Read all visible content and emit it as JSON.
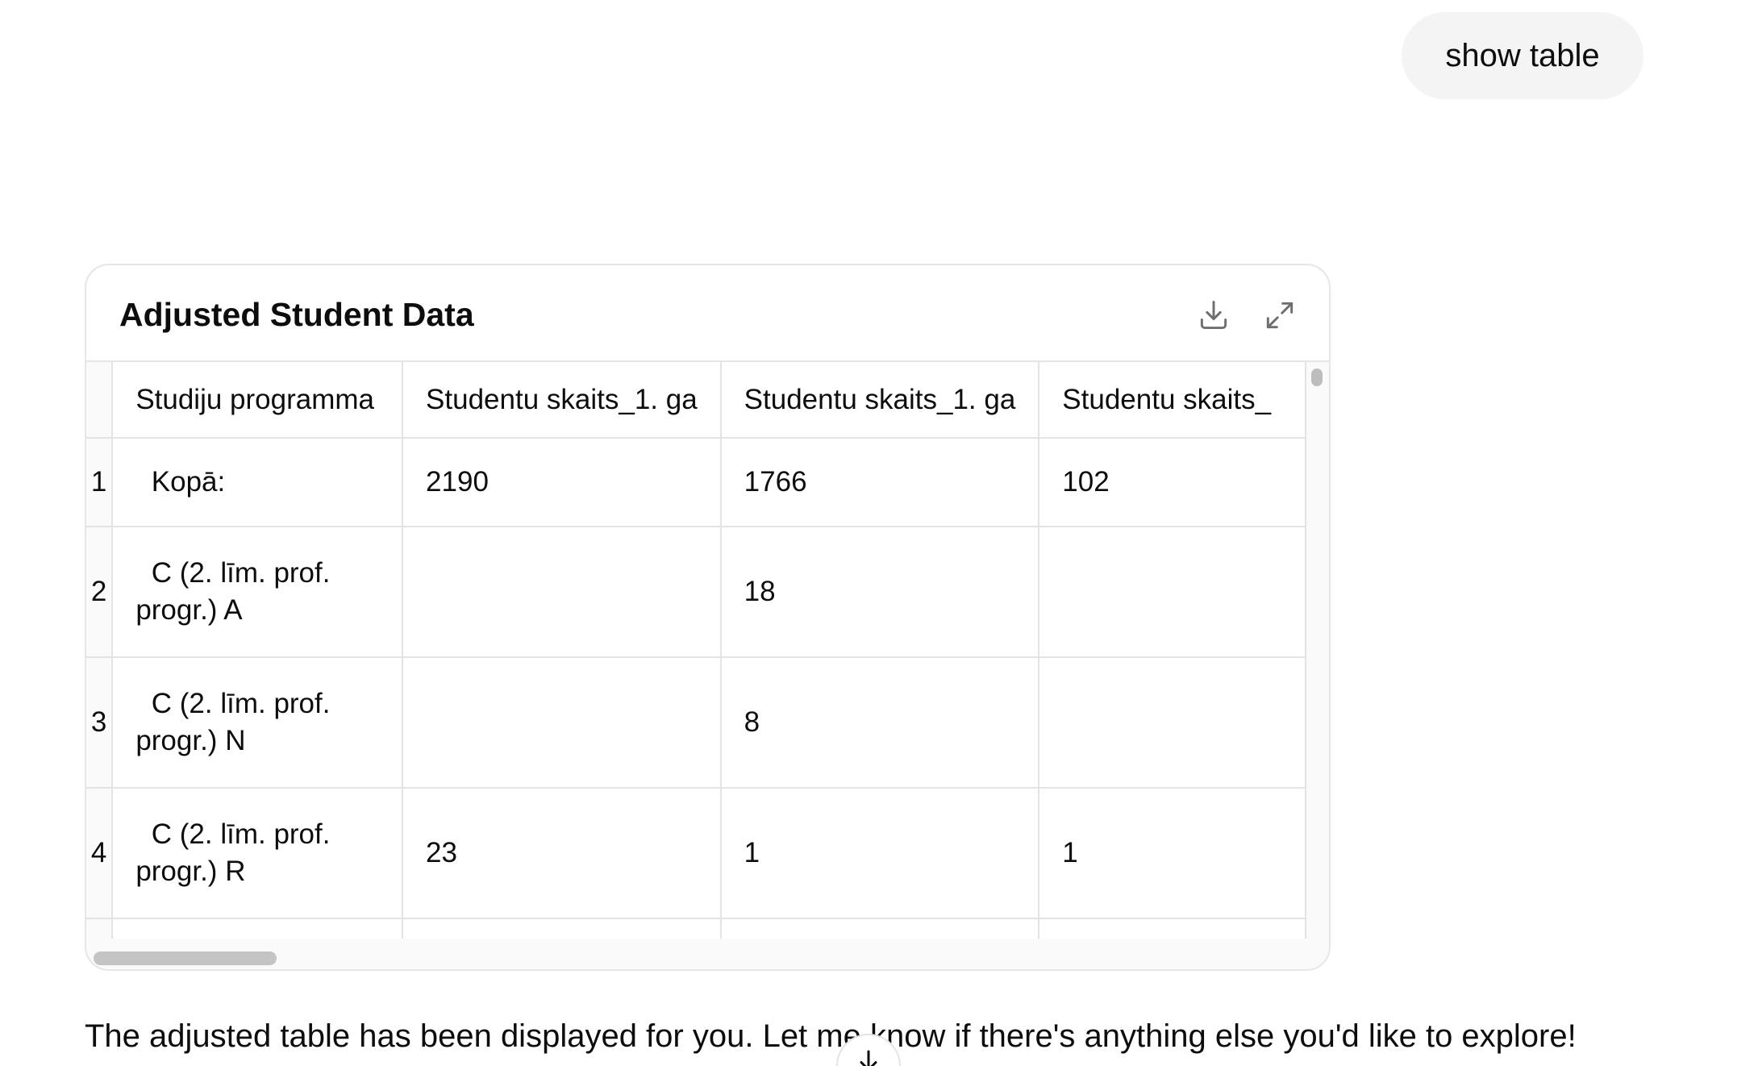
{
  "user_message": {
    "text": "show table"
  },
  "table_card": {
    "title": "Adjusted Student Data",
    "download_icon": "download-icon",
    "expand_icon": "expand-icon",
    "columns": [
      "",
      "Studiju programma",
      "Studentu skaits_1. ga",
      "Studentu skaits_1. ga",
      "Studentu skaits_"
    ],
    "rows": [
      {
        "index": "1",
        "program": "  Kopā:",
        "c1": "2190",
        "c2": "1766",
        "c3": "102"
      },
      {
        "index": "2",
        "program": "  C (2. līm. prof. progr.) A",
        "c1": "",
        "c2": "18",
        "c3": ""
      },
      {
        "index": "3",
        "program": "  C (2. līm. prof. progr.) N",
        "c1": "",
        "c2": "8",
        "c3": ""
      },
      {
        "index": "4",
        "program": "  C (2. līm. prof. progr.) R",
        "c1": "23",
        "c2": "1",
        "c3": "1"
      }
    ]
  },
  "assistant_message": {
    "text": "The adjusted table has been displayed for you. Let me know if there's anything else you'd like to explore!"
  },
  "scroll_down_icon": "arrow-down-icon"
}
